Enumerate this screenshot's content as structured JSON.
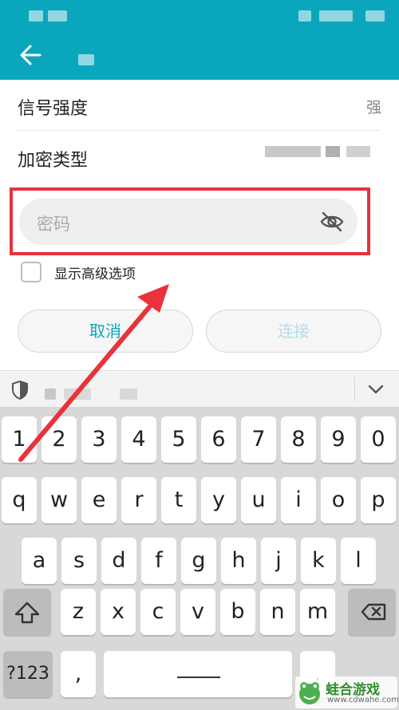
{
  "status_bar": {
    "background": "#0aa6be"
  },
  "app_bar": {
    "back_icon": "arrow-left-icon",
    "background": "#0aa6be"
  },
  "rows": [
    {
      "label": "信号强度",
      "value": "强"
    },
    {
      "label": "加密类型",
      "value": ""
    }
  ],
  "password_field": {
    "placeholder": "密码",
    "toggle_icon": "eye-off-icon"
  },
  "advanced_option": {
    "label": "显示高级选项",
    "checked": false
  },
  "buttons": {
    "cancel": "取消",
    "connect": "连接"
  },
  "keyboard": {
    "toolbar": {
      "security_icon": "shield-icon",
      "collapse_icon": "chevron-down-icon"
    },
    "rows": [
      [
        "1",
        "2",
        "3",
        "4",
        "5",
        "6",
        "7",
        "8",
        "9",
        "0"
      ],
      [
        "q",
        "w",
        "e",
        "r",
        "t",
        "y",
        "u",
        "i",
        "o",
        "p"
      ],
      [
        "a",
        "s",
        "d",
        "f",
        "g",
        "h",
        "j",
        "k",
        "l"
      ],
      [
        "shift",
        "z",
        "x",
        "c",
        "v",
        "b",
        "n",
        "m",
        "backspace"
      ],
      [
        "?123",
        ",",
        "space",
        "."
      ]
    ]
  },
  "annotation": {
    "highlight_color": "#e8323c"
  },
  "watermark": {
    "name": "蛙合游戏",
    "url": "www.cdwahe.com"
  },
  "colors": {
    "accent": "#0aa6be",
    "annotation_red": "#e8323c"
  }
}
